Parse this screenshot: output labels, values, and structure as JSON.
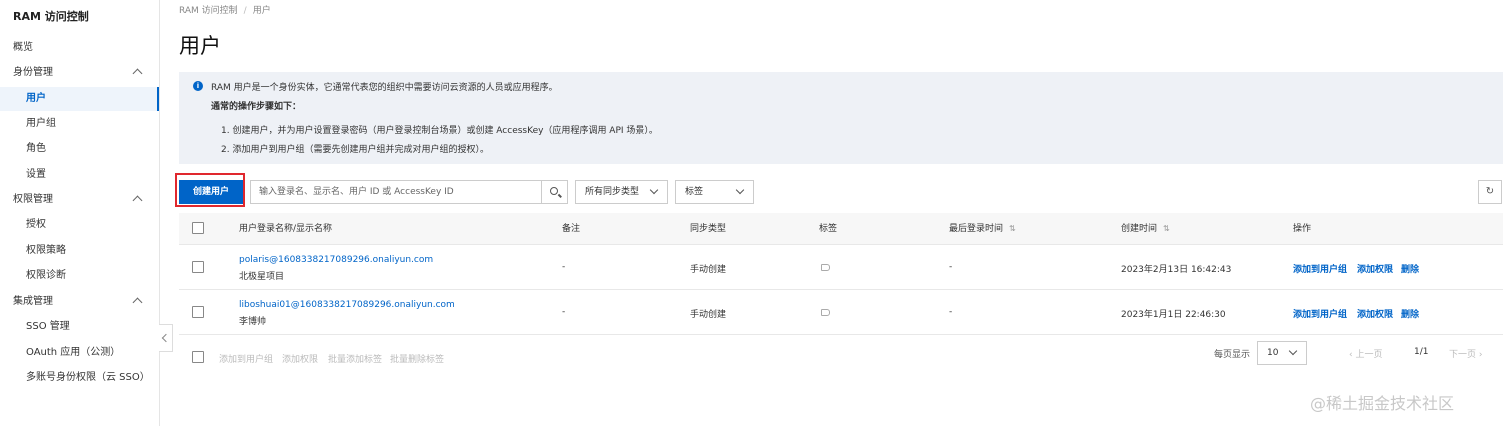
{
  "sidebar": {
    "title": "RAM 访问控制",
    "overview": "概览",
    "groups": [
      {
        "label": "身份管理",
        "items": [
          "用户",
          "用户组",
          "角色",
          "设置"
        ]
      },
      {
        "label": "权限管理",
        "items": [
          "授权",
          "权限策略",
          "权限诊断"
        ]
      },
      {
        "label": "集成管理",
        "items": [
          "SSO 管理",
          "OAuth 应用（公测）",
          "多账号身份权限（云 SSO）"
        ]
      }
    ],
    "active_item": "用户"
  },
  "breadcrumb": {
    "root": "RAM 访问控制",
    "sep": "/",
    "current": "用户"
  },
  "page_title": "用户",
  "notice": {
    "intro": "RAM 用户是一个身份实体，它通常代表您的组织中需要访问云资源的人员或应用程序。",
    "steps_title": "通常的操作步骤如下：",
    "step1": "1. 创建用户，并为用户设置登录密码（用户登录控制台场景）或创建 AccessKey（应用程序调用 API 场景）。",
    "step2": "2. 添加用户到用户组（需要先创建用户组并完成对用户组的授权）。"
  },
  "toolbar": {
    "create_label": "创建用户",
    "search_placeholder": "输入登录名、显示名、用户 ID 或 AccessKey ID",
    "sync_filter": "所有同步类型",
    "tag_filter": "标签",
    "refresh_icon": "↻"
  },
  "table": {
    "headers": {
      "name": "用户登录名称/显示名称",
      "remark": "备注",
      "sync": "同步类型",
      "tag": "标签",
      "last_login": "最后登录时间",
      "created": "创建时间",
      "actions": "操作"
    },
    "sort_icon": "⇅",
    "rows": [
      {
        "login": "polaris@1608338217089296.onaliyun.com",
        "display": "北极星项目",
        "remark": "-",
        "sync": "手动创建",
        "last_login": "-",
        "created": "2023年2月13日 16:42:43"
      },
      {
        "login": "liboshuai01@1608338217089296.onaliyun.com",
        "display": "李博帅",
        "remark": "-",
        "sync": "手动创建",
        "last_login": "-",
        "created": "2023年1月1日 22:46:30"
      }
    ],
    "row_actions": {
      "add_group": "添加到用户组",
      "add_perm": "添加权限",
      "delete": "删除"
    }
  },
  "footer": {
    "bulk_add_group": "添加到用户组",
    "bulk_add_perm": "添加权限",
    "bulk_add_tag": "批量添加标签",
    "bulk_del_tag": "批量删除标签",
    "page_size_label": "每页显示",
    "page_size": "10",
    "prev": "上一页",
    "page_info": "1/1",
    "next": "下一页"
  },
  "watermark": "@稀土掘金技术社区"
}
